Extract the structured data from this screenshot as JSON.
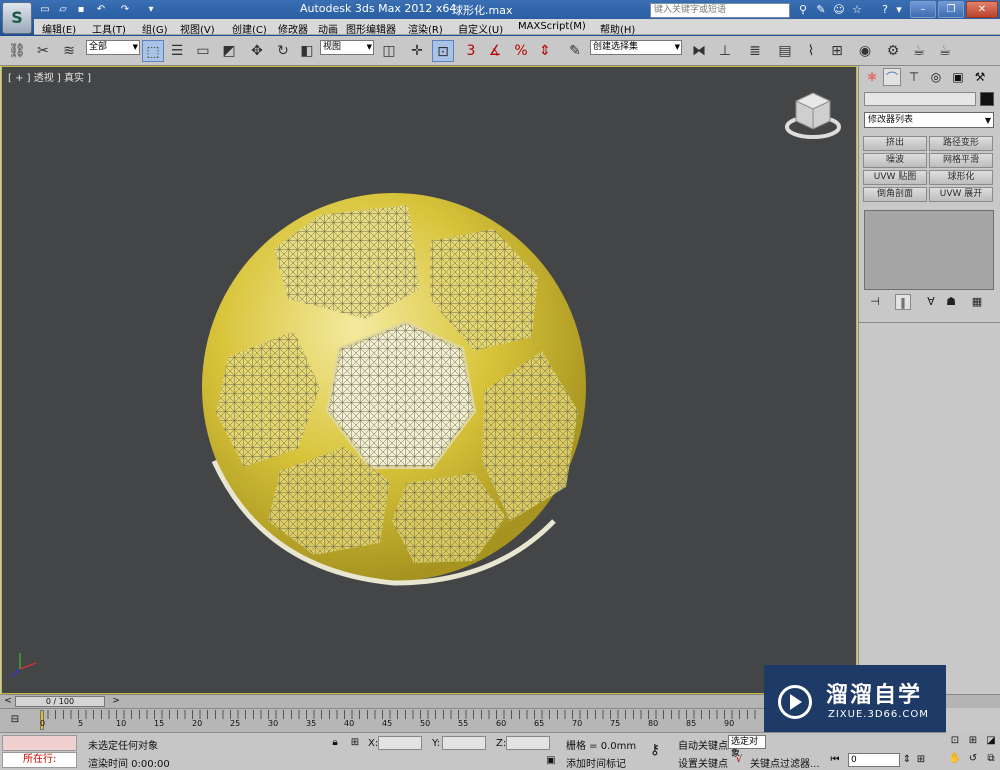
{
  "title": {
    "app": "Autodesk 3ds Max  2012 x64",
    "file": "球形化.max",
    "search_placeholder": "键入关键字或短语"
  },
  "menu": [
    "编辑(E)",
    "工具(T)",
    "组(G)",
    "视图(V)",
    "创建(C)",
    "修改器",
    "动画",
    "图形编辑器",
    "渲染(R)",
    "自定义(U)",
    "MAXScript(M)",
    "帮助(H)"
  ],
  "toolbar": {
    "selection_filter": "全部",
    "reference_coord": "视图",
    "named_selection": "创建选择集"
  },
  "viewport": {
    "label": "[ + ] 透视 ] 真实 ]"
  },
  "command_panel": {
    "modifier_list": "修改器列表",
    "buttons": [
      "挤出",
      "路径变形",
      "噪波",
      "网格平滑",
      "UVW 贴图",
      "球形化",
      "倒角剖面",
      "UVW 展开"
    ]
  },
  "timeline": {
    "slider": "0 / 100",
    "ticks": [
      "0",
      "5",
      "10",
      "15",
      "20",
      "25",
      "30",
      "35",
      "40",
      "45",
      "50",
      "55",
      "60",
      "65",
      "70",
      "75",
      "80",
      "85",
      "90"
    ]
  },
  "status": {
    "running": "所在行:",
    "selection": "未选定任何对象",
    "render_time": "渲染时间  0:00:00",
    "x_label": "X:",
    "y_label": "Y:",
    "z_label": "Z:",
    "grid": "栅格 = 0.0mm",
    "add_time_tag": "添加时间标记",
    "auto_key": "自动关键点",
    "selected_object": "选定对象",
    "set_key": "设置关键点",
    "key_filters": "关键点过滤器...",
    "frame": "0"
  },
  "watermark": {
    "name": "溜溜自学",
    "url": "ZIXUE.3D66.COM"
  },
  "colors": {
    "viewport_bg": "#444547",
    "ball_yellow": "#d8c43a",
    "ball_light": "#f1ecc0",
    "title_blue": "#2a5ea6"
  }
}
